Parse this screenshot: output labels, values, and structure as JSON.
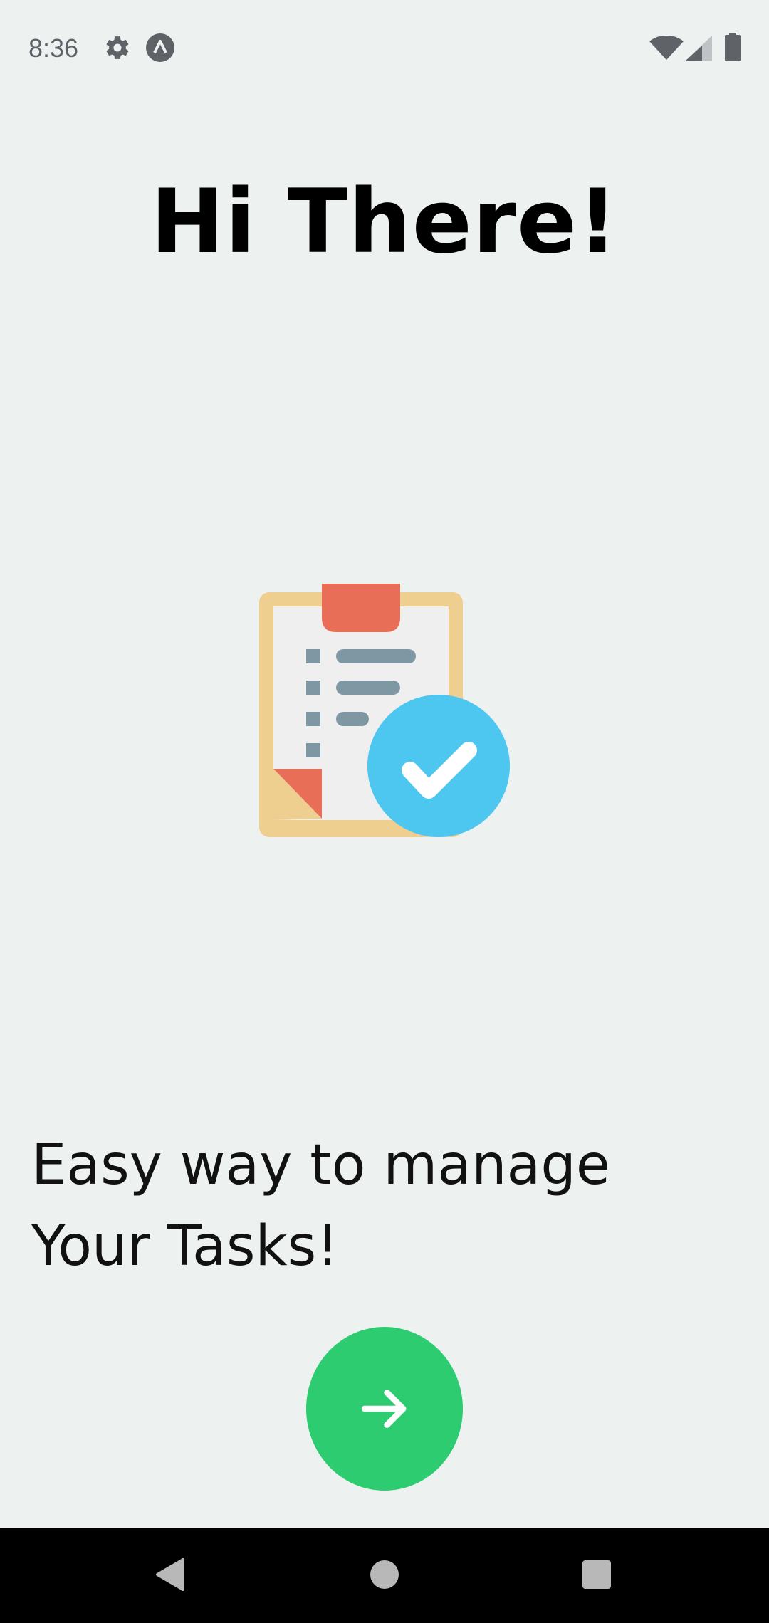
{
  "status_bar": {
    "time": "8:36",
    "left_icons": [
      "gear-icon",
      "app-a-icon"
    ],
    "right_icons": [
      "wifi-icon",
      "signal-icon",
      "battery-icon"
    ]
  },
  "screen": {
    "title": "Hi There!",
    "hero_image": "clipboard-checklist-icon",
    "subtitle": "Easy way to manage Your Tasks!",
    "next_button": {
      "icon": "arrow-right-icon",
      "color": "#2ecc71"
    }
  },
  "nav_bar": {
    "buttons": [
      "back-icon",
      "home-icon",
      "recents-icon"
    ]
  },
  "colors": {
    "background": "#edf2f1",
    "accent_green": "#2ecc71",
    "check_blue": "#4dc7f0",
    "clip_red": "#e96e57",
    "board_tan": "#eecf90"
  }
}
